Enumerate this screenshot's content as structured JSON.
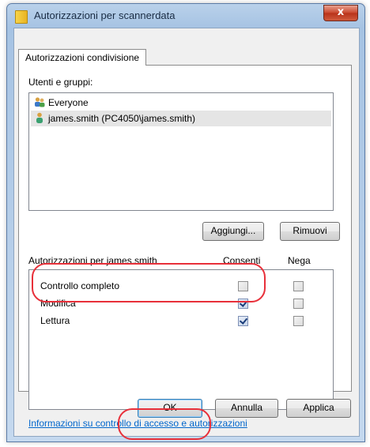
{
  "window": {
    "title": "Autorizzazioni per scannerdata",
    "close_label": "x"
  },
  "tabs": [
    {
      "label": "Autorizzazioni condivisione",
      "active": true
    }
  ],
  "users": {
    "label": "Utenti e gruppi:",
    "items": [
      {
        "name": "Everyone",
        "icon": "group-icon",
        "selected": false
      },
      {
        "name": "james.smith (PC4050\\james.smith)",
        "icon": "user-icon",
        "selected": true
      }
    ],
    "add_label": "Aggiungi...",
    "remove_label": "Rimuovi"
  },
  "permissions": {
    "header_label": "Autorizzazioni per james.smith",
    "allow_label": "Consenti",
    "deny_label": "Nega",
    "rows": [
      {
        "name": "Controllo completo",
        "allow": false,
        "deny": false
      },
      {
        "name": "Modifica",
        "allow": true,
        "deny": false
      },
      {
        "name": "Lettura",
        "allow": true,
        "deny": false
      }
    ]
  },
  "link_text": "Informazioni su controllo di accesso e autorizzazioni",
  "buttons": {
    "ok": "OK",
    "cancel": "Annulla",
    "apply": "Applica"
  },
  "colors": {
    "highlight": "#e8303a",
    "link": "#0066cc"
  }
}
